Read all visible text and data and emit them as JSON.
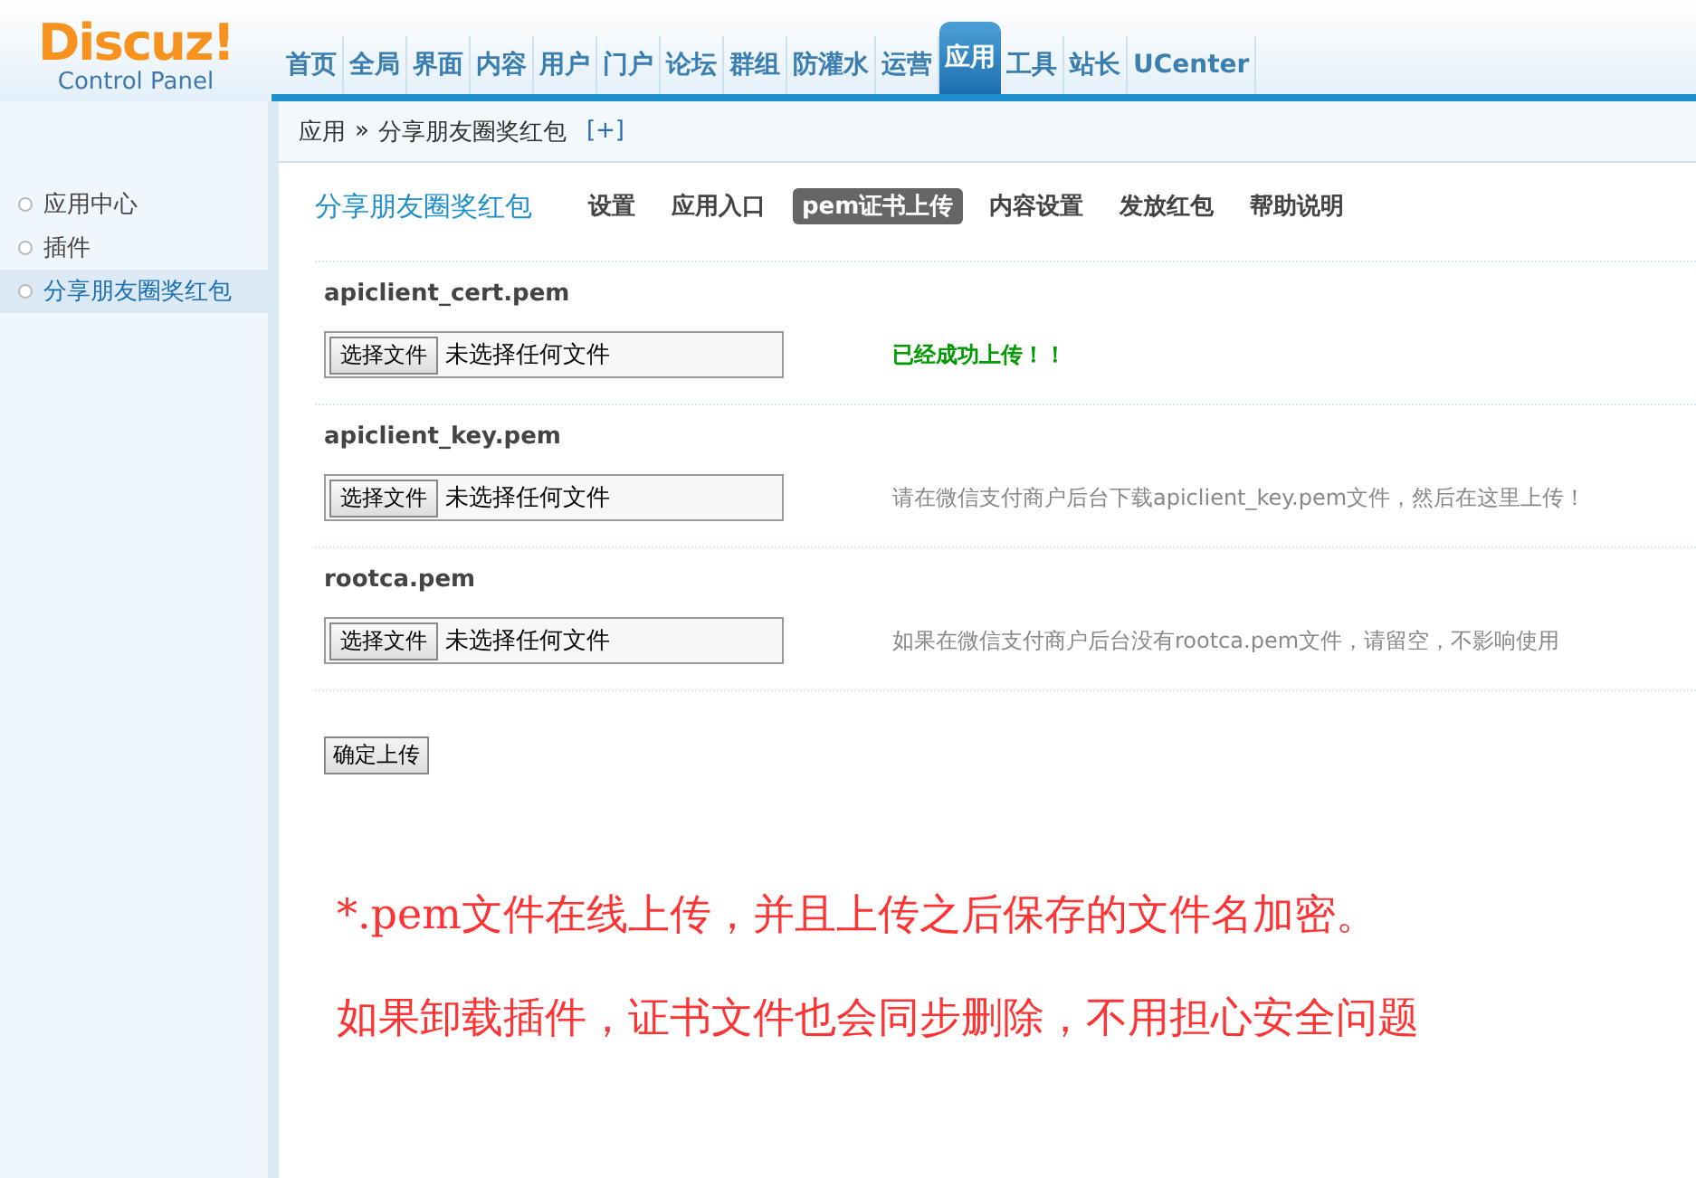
{
  "logo": {
    "name": "Discuz!",
    "subtitle": "Control Panel"
  },
  "nav": [
    {
      "label": "首页",
      "selected": false
    },
    {
      "label": "全局",
      "selected": false
    },
    {
      "label": "界面",
      "selected": false
    },
    {
      "label": "内容",
      "selected": false
    },
    {
      "label": "用户",
      "selected": false
    },
    {
      "label": "门户",
      "selected": false
    },
    {
      "label": "论坛",
      "selected": false
    },
    {
      "label": "群组",
      "selected": false
    },
    {
      "label": "防灌水",
      "selected": false
    },
    {
      "label": "运营",
      "selected": false
    },
    {
      "label": "应用",
      "selected": true
    },
    {
      "label": "工具",
      "selected": false
    },
    {
      "label": "站长",
      "selected": false
    },
    {
      "label": "UCenter",
      "selected": false
    }
  ],
  "breadcrumb": {
    "parent": "应用",
    "separator": "»",
    "current": "分享朋友圈奖红包",
    "add": "[+]"
  },
  "sidebar": {
    "items": [
      {
        "label": "应用中心",
        "selected": false
      },
      {
        "label": "插件",
        "selected": false
      },
      {
        "label": "分享朋友圈奖红包",
        "selected": true
      }
    ]
  },
  "plugin_title": "分享朋友圈奖红包",
  "tabs": [
    {
      "label": "设置",
      "selected": false
    },
    {
      "label": "应用入口",
      "selected": false
    },
    {
      "label": "pem证书上传",
      "selected": true
    },
    {
      "label": "内容设置",
      "selected": false
    },
    {
      "label": "发放红包",
      "selected": false
    },
    {
      "label": "帮助说明",
      "selected": false
    }
  ],
  "fields": [
    {
      "label": "apiclient_cert.pem",
      "button": "选择文件",
      "file": "未选择任何文件",
      "note": "已经成功上传！！",
      "kind": "success"
    },
    {
      "label": "apiclient_key.pem",
      "button": "选择文件",
      "file": "未选择任何文件",
      "note": "请在微信支付商户后台下载apiclient_key.pem文件，然后在这里上传！",
      "kind": "hint"
    },
    {
      "label": "rootca.pem",
      "button": "选择文件",
      "file": "未选择任何文件",
      "note": "如果在微信支付商户后台没有rootca.pem文件，请留空，不影响使用",
      "kind": "hint"
    }
  ],
  "submit": "确定上传",
  "notes": [
    "*.pem文件在线上传，并且上传之后保存的文件名加密。",
    "如果卸载插件，证书文件也会同步删除，不用担心安全问题"
  ]
}
